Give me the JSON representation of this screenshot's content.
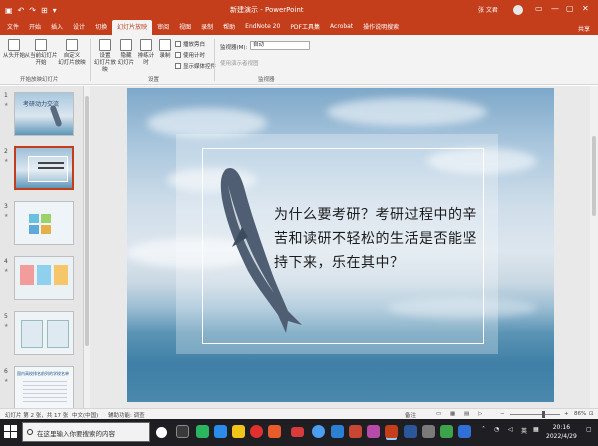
{
  "titlebar": {
    "title": "新建演示 - PowerPoint",
    "user": "张 文君",
    "qat": [
      "↶",
      "↷",
      "⊞",
      "▾"
    ],
    "win_controls": [
      "—",
      "▢",
      "✕"
    ]
  },
  "tabs": [
    {
      "label": "文件",
      "active": false
    },
    {
      "label": "开始",
      "active": false
    },
    {
      "label": "插入",
      "active": false
    },
    {
      "label": "设计",
      "active": false
    },
    {
      "label": "切换",
      "active": false
    },
    {
      "label": "幻灯片放映",
      "active": true
    },
    {
      "label": "审阅",
      "active": false
    },
    {
      "label": "视图",
      "active": false
    },
    {
      "label": "录制",
      "active": false
    },
    {
      "label": "帮助",
      "active": false
    },
    {
      "label": "EndNote 20",
      "active": false
    },
    {
      "label": "PDF工具集",
      "active": false
    },
    {
      "label": "Acrobat",
      "active": false
    },
    {
      "label": "操作说明搜索",
      "active": false
    }
  ],
  "share_label": "共享",
  "ribbon": {
    "group1": {
      "btn_from_start": "从头开始",
      "btn_from_current": "从当前幻灯片\n开始",
      "btn_custom": "自定义\n幻灯片放映",
      "label": "开始放映幻灯片"
    },
    "group2": {
      "btn_setup": "设置\n幻灯片放映",
      "btn_hide": "隐藏\n幻灯片",
      "btn_rehearse": "排练计时",
      "btn_record": "录制",
      "chk_play_narrations": "播放旁白",
      "chk_use_timings": "使用计时",
      "chk_show_controls": "显示媒体控件",
      "label": "设置"
    },
    "group3": {
      "monitor_label": "监视器(M):",
      "monitor_value": "自动",
      "presenter_view": "使用演示者视图",
      "label": "监视器"
    }
  },
  "thumbnails": [
    {
      "number": "1",
      "title": "考研动力交流"
    },
    {
      "number": "2",
      "title": ""
    },
    {
      "number": "3",
      "title": ""
    },
    {
      "number": "4",
      "title": ""
    },
    {
      "number": "5",
      "title": ""
    },
    {
      "number": "6",
      "title": "国内高校排名前列的学校名单"
    }
  ],
  "slide": {
    "text": "为什么要考研？考研过程中的辛苦和读研不轻松的生活是否能坚持下来，乐在其中？"
  },
  "status": {
    "slide_info": "幻灯片 第 2 张，共 17 张",
    "language": "中文(中国)",
    "accessibility": "辅助功能: 调查",
    "notes": "备注",
    "zoom": "86%"
  },
  "taskbar": {
    "search_placeholder": "在这里输入你要搜索的内容",
    "tray_lang": "英",
    "time": "20:16",
    "date": "2022/4/29"
  }
}
